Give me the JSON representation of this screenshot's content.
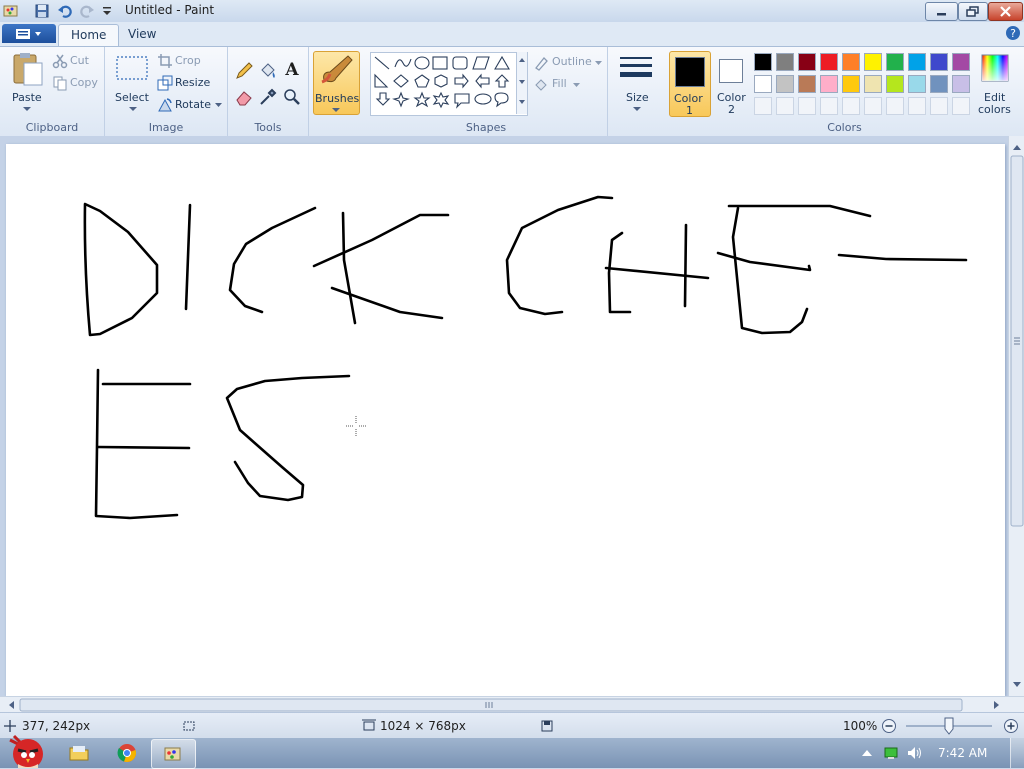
{
  "window": {
    "title": "Untitled - Paint"
  },
  "tabs": {
    "file": "",
    "home": "Home",
    "view": "View"
  },
  "clipboard": {
    "paste": "Paste",
    "cut": "Cut",
    "copy": "Copy",
    "group": "Clipboard"
  },
  "image": {
    "select": "Select",
    "crop": "Crop",
    "resize": "Resize",
    "rotate": "Rotate",
    "group": "Image"
  },
  "tools": {
    "group": "Tools",
    "text_tool": "A"
  },
  "brushes": {
    "label": "Brushes"
  },
  "shapes": {
    "outline": "Outline",
    "fill": "Fill",
    "group": "Shapes"
  },
  "size": {
    "label": "Size"
  },
  "colors": {
    "color1_label_a": "Color",
    "color1_label_b": "1",
    "color2_label_a": "Color",
    "color2_label_b": "2",
    "edit_a": "Edit",
    "edit_b": "colors",
    "group": "Colors",
    "color1": "#000000",
    "color2": "#ffffff",
    "palette_row1": [
      "#000000",
      "#7f7f7f",
      "#880015",
      "#ed1c24",
      "#ff7f27",
      "#fff200",
      "#22b14c",
      "#00a2e8",
      "#3f48cc",
      "#a349a4"
    ],
    "palette_row2": [
      "#ffffff",
      "#c3c3c3",
      "#b97a57",
      "#ffaec9",
      "#ffc90e",
      "#efe4b0",
      "#b5e61d",
      "#99d9ea",
      "#7092be",
      "#c8bfe7"
    ]
  },
  "status": {
    "cursor": "377, 242px",
    "dimensions": "1024 × 768px",
    "zoom": "100%"
  },
  "taskbar": {
    "clock": "7:42 AM"
  }
}
